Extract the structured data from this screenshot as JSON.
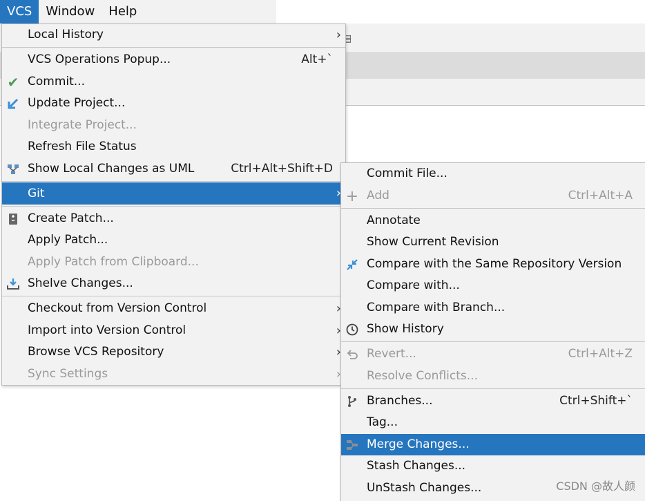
{
  "menubar": {
    "vcs": "VCS",
    "window": "Window",
    "help": "Help"
  },
  "vcs_menu": {
    "local_history": "Local History",
    "vcs_operations_popup": "VCS Operations Popup...",
    "vcs_operations_popup_shortcut": "Alt+`",
    "commit": "Commit...",
    "update_project": "Update Project...",
    "integrate_project": "Integrate Project...",
    "refresh_file_status": "Refresh File Status",
    "show_local_changes_uml": "Show Local Changes as UML",
    "show_local_changes_uml_shortcut": "Ctrl+Alt+Shift+D",
    "git": "Git",
    "create_patch": "Create Patch...",
    "apply_patch": "Apply Patch...",
    "apply_patch_clipboard": "Apply Patch from Clipboard...",
    "shelve_changes": "Shelve Changes...",
    "checkout_vc": "Checkout from Version Control",
    "import_vc": "Import into Version Control",
    "browse_vcs": "Browse VCS Repository",
    "sync_settings": "Sync Settings"
  },
  "git_menu": {
    "commit_file": "Commit File...",
    "add": "Add",
    "add_shortcut": "Ctrl+Alt+A",
    "annotate": "Annotate",
    "show_current_revision": "Show Current Revision",
    "compare_same_repo": "Compare with the Same Repository Version",
    "compare_with": "Compare with...",
    "compare_with_branch": "Compare with Branch...",
    "show_history": "Show History",
    "revert": "Revert...",
    "revert_shortcut": "Ctrl+Alt+Z",
    "resolve_conflicts": "Resolve Conflicts...",
    "branches": "Branches...",
    "branches_shortcut": "Ctrl+Shift+`",
    "tag": "Tag...",
    "merge_changes": "Merge Changes...",
    "stash_changes": "Stash Changes...",
    "unstash_changes": "UnStash Changes..."
  },
  "watermark": "CSDN @故人颜",
  "icons": {
    "commit": "check-icon",
    "update": "update-arrow-icon",
    "uml": "uml-diagram-icon",
    "patch": "patch-icon",
    "shelve": "shelve-icon",
    "add": "plus-icon",
    "compare": "compare-arrows-icon",
    "history": "clock-icon",
    "revert": "undo-icon",
    "branches": "branch-icon",
    "merge": "merge-icon"
  },
  "colors": {
    "selection": "#2675bf",
    "menu_bg": "#f2f2f2",
    "disabled_text": "#9a9a9a",
    "check_green": "#4e9a56",
    "icon_blue": "#3b8fd6"
  }
}
